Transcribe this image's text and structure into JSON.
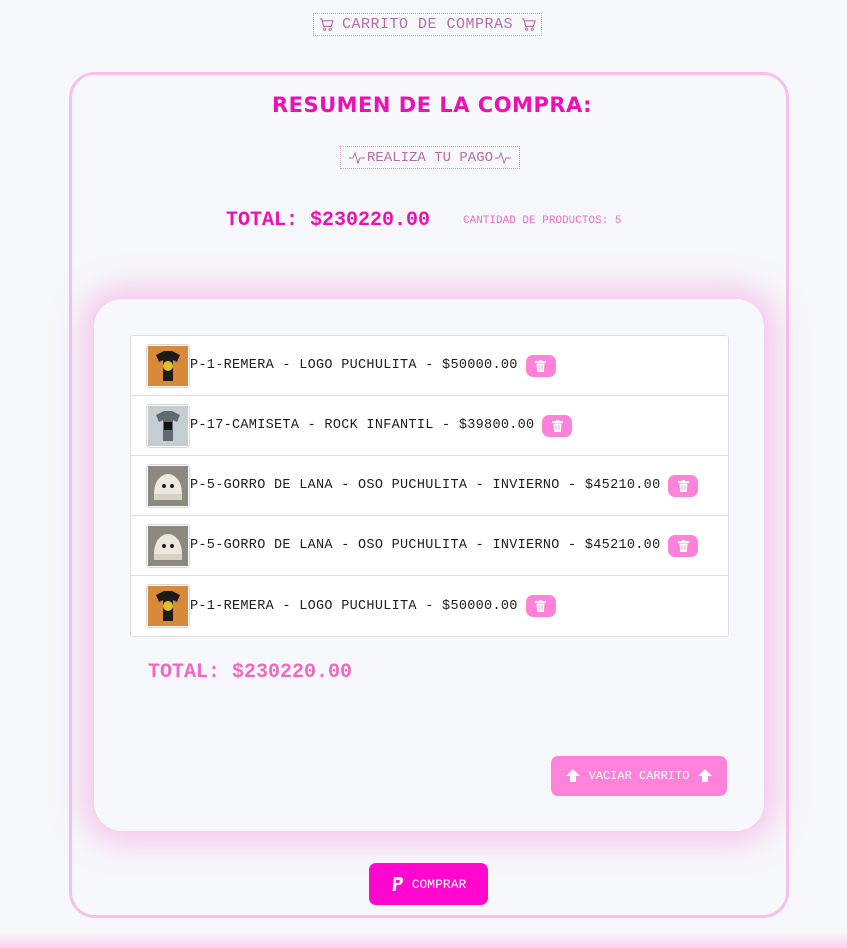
{
  "header": {
    "title": "CARRITO DE COMPRAS"
  },
  "summary": {
    "title": "RESUMEN DE LA COMPRA:",
    "pay_label": "REALIZA TU PAGO",
    "total": "TOTAL: $230220.00",
    "quantity": "CANTIDAD DE PRODUCTOS: 5"
  },
  "cart": {
    "items": [
      {
        "label": "P-1-REMERA - LOGO PUCHULITA - $50000.00",
        "thumb_icon": "black-tshirt-thumbnail"
      },
      {
        "label": "P-17-CAMISETA - ROCK INFANTIL - $39800.00",
        "thumb_icon": "gray-tshirt-thumbnail"
      },
      {
        "label": "P-5-GORRO DE LANA - OSO PUCHULITA - INVIERNO - $45210.00",
        "thumb_icon": "beanie-thumbnail"
      },
      {
        "label": "P-5-GORRO DE LANA - OSO PUCHULITA - INVIERNO - $45210.00",
        "thumb_icon": "beanie-thumbnail"
      },
      {
        "label": "P-1-REMERA - LOGO PUCHULITA - $50000.00",
        "thumb_icon": "black-tshirt-thumbnail"
      }
    ],
    "total": "TOTAL: $230220.00",
    "empty_label": "VACIAR CARRITO"
  },
  "checkout": {
    "buy_label": "COMPRAR"
  },
  "colors": {
    "accent": "#f00fb4",
    "button_pink": "#fd82d9",
    "buy_button": "#ff07ce",
    "border_pink": "#f7c0ec"
  }
}
